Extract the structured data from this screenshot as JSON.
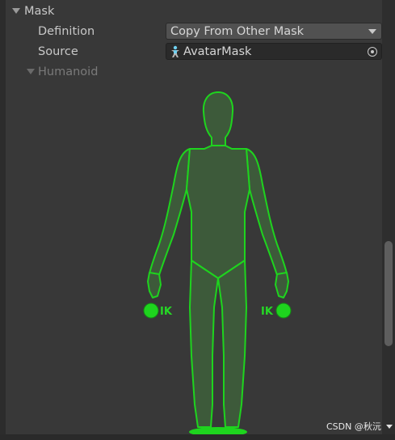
{
  "mask": {
    "title": "Mask",
    "definition": {
      "label": "Definition",
      "value": "Copy From Other Mask"
    },
    "source": {
      "label": "Source",
      "value": "AvatarMask"
    },
    "humanoid": {
      "label": "Humanoid"
    }
  },
  "figure": {
    "left_ik_label": "IK",
    "right_ik_label": "IK",
    "active_color": "#1ed41e",
    "body_fill": "#3d5a3a"
  },
  "watermark": {
    "text": "CSDN @秋沅"
  }
}
